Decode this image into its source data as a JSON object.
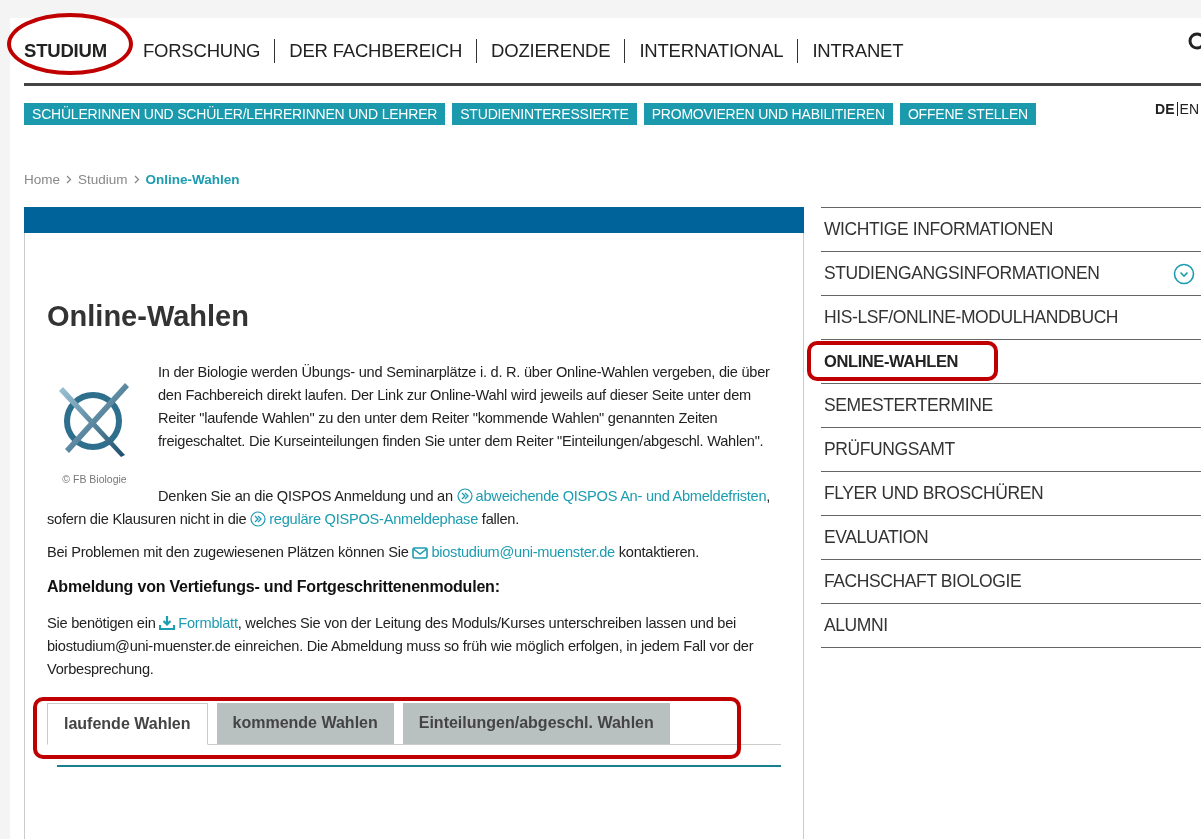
{
  "main_nav": [
    {
      "label": "STUDIUM",
      "selected": true,
      "annotated": true
    },
    {
      "label": "FORSCHUNG",
      "selected": false,
      "annotated": false
    },
    {
      "label": "DER FACHBEREICH",
      "selected": false,
      "annotated": false
    },
    {
      "label": "DOZIERENDE",
      "selected": false,
      "annotated": false
    },
    {
      "label": "INTERNATIONAL",
      "selected": false,
      "annotated": false
    },
    {
      "label": "INTRANET",
      "selected": false,
      "annotated": false
    }
  ],
  "sub_nav": [
    "SCHÜLERINNEN UND SCHÜLER/LEHRERINNEN UND LEHRER",
    "STUDIENINTERESSIERTE",
    "PROMOVIEREN UND HABILITIEREN",
    "OFFENE STELLEN"
  ],
  "languages": [
    {
      "label": "DE",
      "selected": true
    },
    {
      "label": "EN",
      "selected": false
    }
  ],
  "breadcrumb": [
    {
      "label": "Home",
      "current": false
    },
    {
      "label": "Studium",
      "current": false
    },
    {
      "label": "Online-Wahlen",
      "current": true
    }
  ],
  "title": "Online-Wahlen",
  "image_caption": "© FB Biologie",
  "paragraphs": [
    {
      "kind": "intro",
      "segments": [
        {
          "kind": "text",
          "text": "In der Biologie werden Übungs- und Seminarplätze i. d. R. über Online-Wahlen vergeben, die über den Fachbereich direkt laufen. Der Link zur Online-Wahl wird jeweils auf dieser Seite unter dem Reiter \"laufende Wahlen\" zu den unter dem Reiter \"kommende Wahlen\" genannten Zeiten freigeschaltet. Die Kurseinteilungen finden Sie unter dem Reiter \"Einteilungen/abgeschl. Wahlen\"."
        }
      ]
    },
    {
      "kind": "body",
      "segments": [
        {
          "kind": "text",
          "text": "Denken Sie an die QISPOS Anmeldung und an "
        },
        {
          "kind": "chevron-link",
          "text": "abweichende QISPOS An- und Abmeldefristen"
        },
        {
          "kind": "text",
          "text": ", sofern die Klausuren nicht in die "
        },
        {
          "kind": "chevron-link",
          "text": "reguläre QISPOS-Anmeldephase"
        },
        {
          "kind": "text",
          "text": " fallen."
        }
      ]
    },
    {
      "kind": "body",
      "segments": [
        {
          "kind": "text",
          "text": "Bei Problemen mit den zugewiesenen Plätzen können Sie "
        },
        {
          "kind": "mail-link",
          "text": "biostudium@uni-muenster.de"
        },
        {
          "kind": "text",
          "text": " kontaktieren."
        }
      ]
    },
    {
      "kind": "heading",
      "segments": [
        {
          "kind": "text",
          "text": "Abmeldung von Vertiefungs- und Fortgeschrittenenmodulen:"
        }
      ]
    },
    {
      "kind": "body",
      "segments": [
        {
          "kind": "text",
          "text": "Sie benötigen ein "
        },
        {
          "kind": "download-link",
          "text": "Formblatt"
        },
        {
          "kind": "text",
          "text": ", welches Sie von der Leitung des Moduls/Kurses unterschreiben lassen und bei biostudium@uni-muenster.de einreichen. Die Abmeldung muss so früh wie möglich erfolgen, in jedem Fall vor der Vorbesprechung."
        }
      ]
    }
  ],
  "tabs": {
    "annotated": true,
    "items": [
      {
        "label": "laufende Wahlen",
        "selected": true
      },
      {
        "label": "kommende Wahlen",
        "selected": false
      },
      {
        "label": "Einteilungen/abgeschl. Wahlen",
        "selected": false
      }
    ]
  },
  "sidebar": {
    "items": [
      {
        "label": "WICHTIGE INFORMATIONEN",
        "selected": false,
        "expandable": false,
        "annotated": false
      },
      {
        "label": "STUDIENGANGSINFORMATIONEN",
        "selected": false,
        "expandable": true,
        "annotated": false
      },
      {
        "label": "HIS-LSF/ONLINE-MODULHANDBUCH",
        "selected": false,
        "expandable": false,
        "annotated": false
      },
      {
        "label": "ONLINE-WAHLEN",
        "selected": true,
        "expandable": false,
        "annotated": true
      },
      {
        "label": "SEMESTERTERMINE",
        "selected": false,
        "expandable": false,
        "annotated": false
      },
      {
        "label": "PRÜFUNGSAMT",
        "selected": false,
        "expandable": false,
        "annotated": false
      },
      {
        "label": "FLYER UND BROSCHÜREN",
        "selected": false,
        "expandable": false,
        "annotated": false
      },
      {
        "label": "EVALUATION",
        "selected": false,
        "expandable": false,
        "annotated": false
      },
      {
        "label": "FACHSCHAFT BIOLOGIE",
        "selected": false,
        "expandable": false,
        "annotated": false
      },
      {
        "label": "ALUMNI",
        "selected": false,
        "expandable": false,
        "annotated": false
      }
    ]
  }
}
